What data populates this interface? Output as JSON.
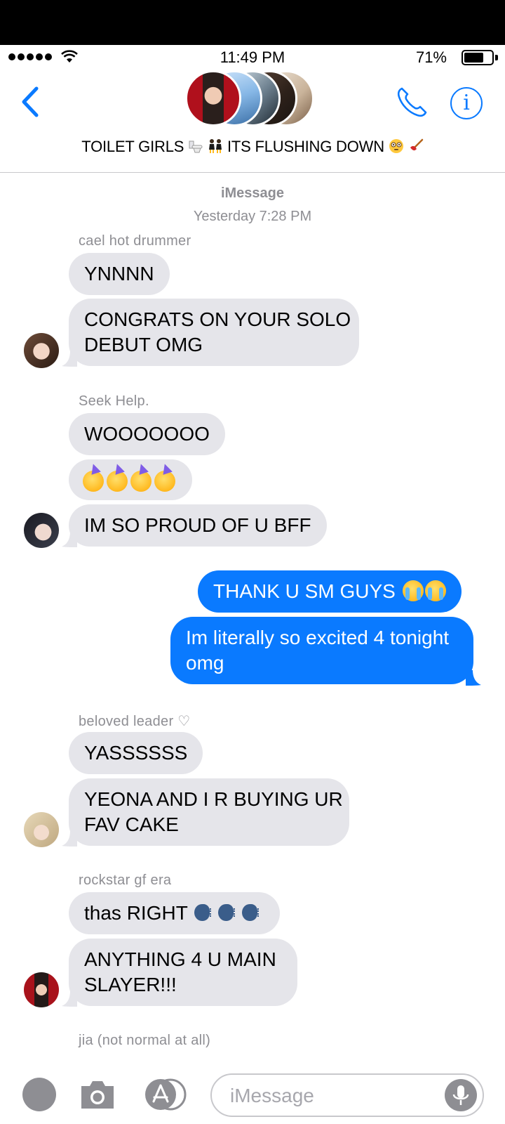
{
  "status": {
    "time": "11:49 PM",
    "battery": "71%",
    "battery_level": 0.71
  },
  "header": {
    "group_title": "TOILET GIRLS",
    "group_title_suffix": "ITS FLUSHING DOWN",
    "title_emoji": [
      "toilet",
      "dancing-women",
      "flushed-face",
      "plunger"
    ]
  },
  "meta": {
    "service": "iMessage",
    "timestamp": "Yesterday 7:28 PM"
  },
  "messages": [
    {
      "sender": "cael hot drummer",
      "bubbles": [
        "YNNNN",
        "CONGRATS ON YOUR SOLO",
        "DEBUT OMG"
      ]
    },
    {
      "sender": "Seek Help.",
      "bubbles": [
        "WOOOOOOO",
        "IM SO PROUD OF U BFF"
      ]
    },
    {
      "sender": "me",
      "bubbles": [
        "THANK U SM GUYS",
        "Im literally so excited 4 tonight",
        "omg"
      ]
    },
    {
      "sender": "beloved leader ♡",
      "bubbles": [
        "YASSSSSS",
        "YEONA AND I R BUYING UR",
        "FAV CAKE"
      ]
    },
    {
      "sender": "rockstar gf era",
      "bubbles": [
        "thas RIGHT",
        "ANYTHING 4 U MAIN",
        "SLAYER!!!"
      ]
    },
    {
      "sender": "jia (not normal at all)"
    }
  ],
  "emoji": {
    "party_face": "partying-face",
    "crying": "loudly-crying-face",
    "speaking_head": "speaking-head"
  },
  "input": {
    "placeholder": "iMessage"
  },
  "colors": {
    "accent": "#0a7aff",
    "received_bubble": "#e5e5ea",
    "meta_text": "#8e8e93"
  }
}
